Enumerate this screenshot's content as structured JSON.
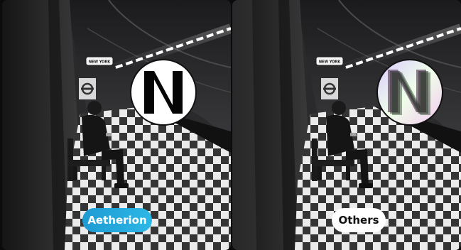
{
  "comparison": {
    "left_label": "Aetherion",
    "right_label": "Others"
  },
  "scene": {
    "sign_text": "NEW YORK",
    "zoom_glyph": "N"
  },
  "colors": {
    "accent_pill_start": "#1e9bd3",
    "accent_pill_end": "#2cb7e6",
    "secondary_pill": "#ffffff"
  },
  "icons": [
    "zoom-magnifier-circle",
    "station-roundel-icon"
  ]
}
